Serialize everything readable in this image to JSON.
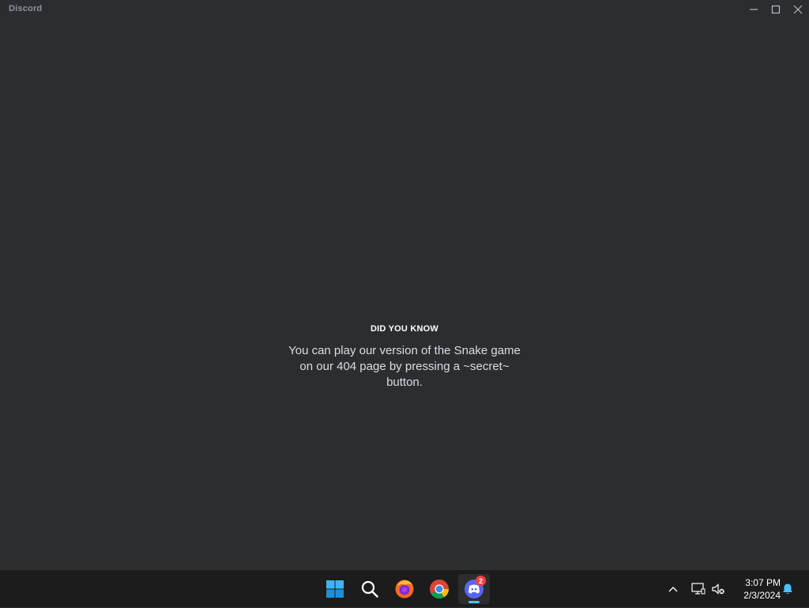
{
  "window": {
    "title": "Discord"
  },
  "tip": {
    "heading": "DID YOU KNOW",
    "body": "You can play our version of the Snake game on our 404 page by pressing a ~secret~ button."
  },
  "taskbar": {
    "apps": [
      {
        "name": "Start",
        "icon": "windows-start-icon"
      },
      {
        "name": "Search",
        "icon": "search-icon"
      },
      {
        "name": "Firefox",
        "icon": "firefox-icon"
      },
      {
        "name": "Chrome",
        "icon": "chrome-icon"
      },
      {
        "name": "Discord",
        "icon": "discord-icon",
        "badge": "2",
        "active": true
      }
    ],
    "clock": {
      "time": "3:07 PM",
      "date": "2/3/2024"
    }
  },
  "colors": {
    "background": "#2b2d31",
    "taskbar": "#1c1c1c",
    "badge": "#f23f43",
    "discord_blurple": "#5865f2",
    "accent": "#4cc2ff"
  }
}
